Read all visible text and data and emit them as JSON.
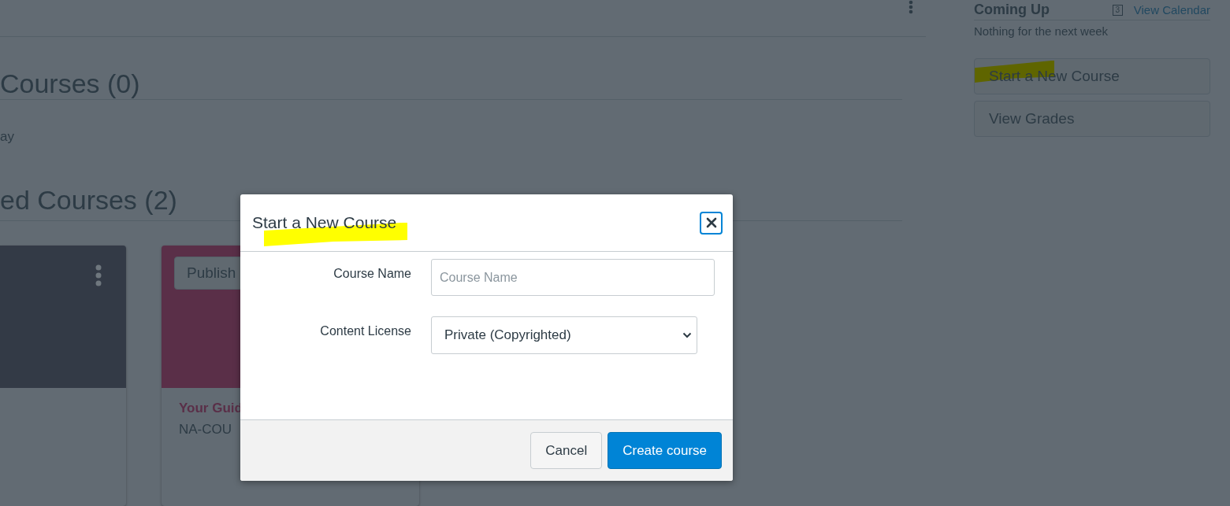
{
  "sections": [
    {
      "heading": "Courses (0)",
      "text": "ay"
    },
    {
      "heading": "ed Courses (2)"
    }
  ],
  "cards": [
    {
      "color": "#333a46",
      "menu": true
    },
    {
      "color": "#5a2f48",
      "publish_button": "Publish",
      "title": "Your Guid",
      "code": "NA-COU"
    }
  ],
  "sidebar": {
    "heading": "Coming Up",
    "calendar_day": "3",
    "calendar_link": "View Calendar",
    "empty_text": "Nothing for the next week",
    "buttons": [
      {
        "label": "Start a New Course",
        "highlighted": true
      },
      {
        "label": "View Grades",
        "highlighted": false
      }
    ]
  },
  "modal": {
    "title": "Start a New Course",
    "title_highlighted": true,
    "fields": [
      {
        "kind": "text",
        "label": "Course Name",
        "placeholder": "Course Name"
      },
      {
        "kind": "select",
        "label": "Content License",
        "value": "Private (Copyrighted)"
      }
    ],
    "buttons": [
      {
        "label": "Cancel",
        "primary": false
      },
      {
        "label": "Create course",
        "primary": true
      }
    ]
  }
}
